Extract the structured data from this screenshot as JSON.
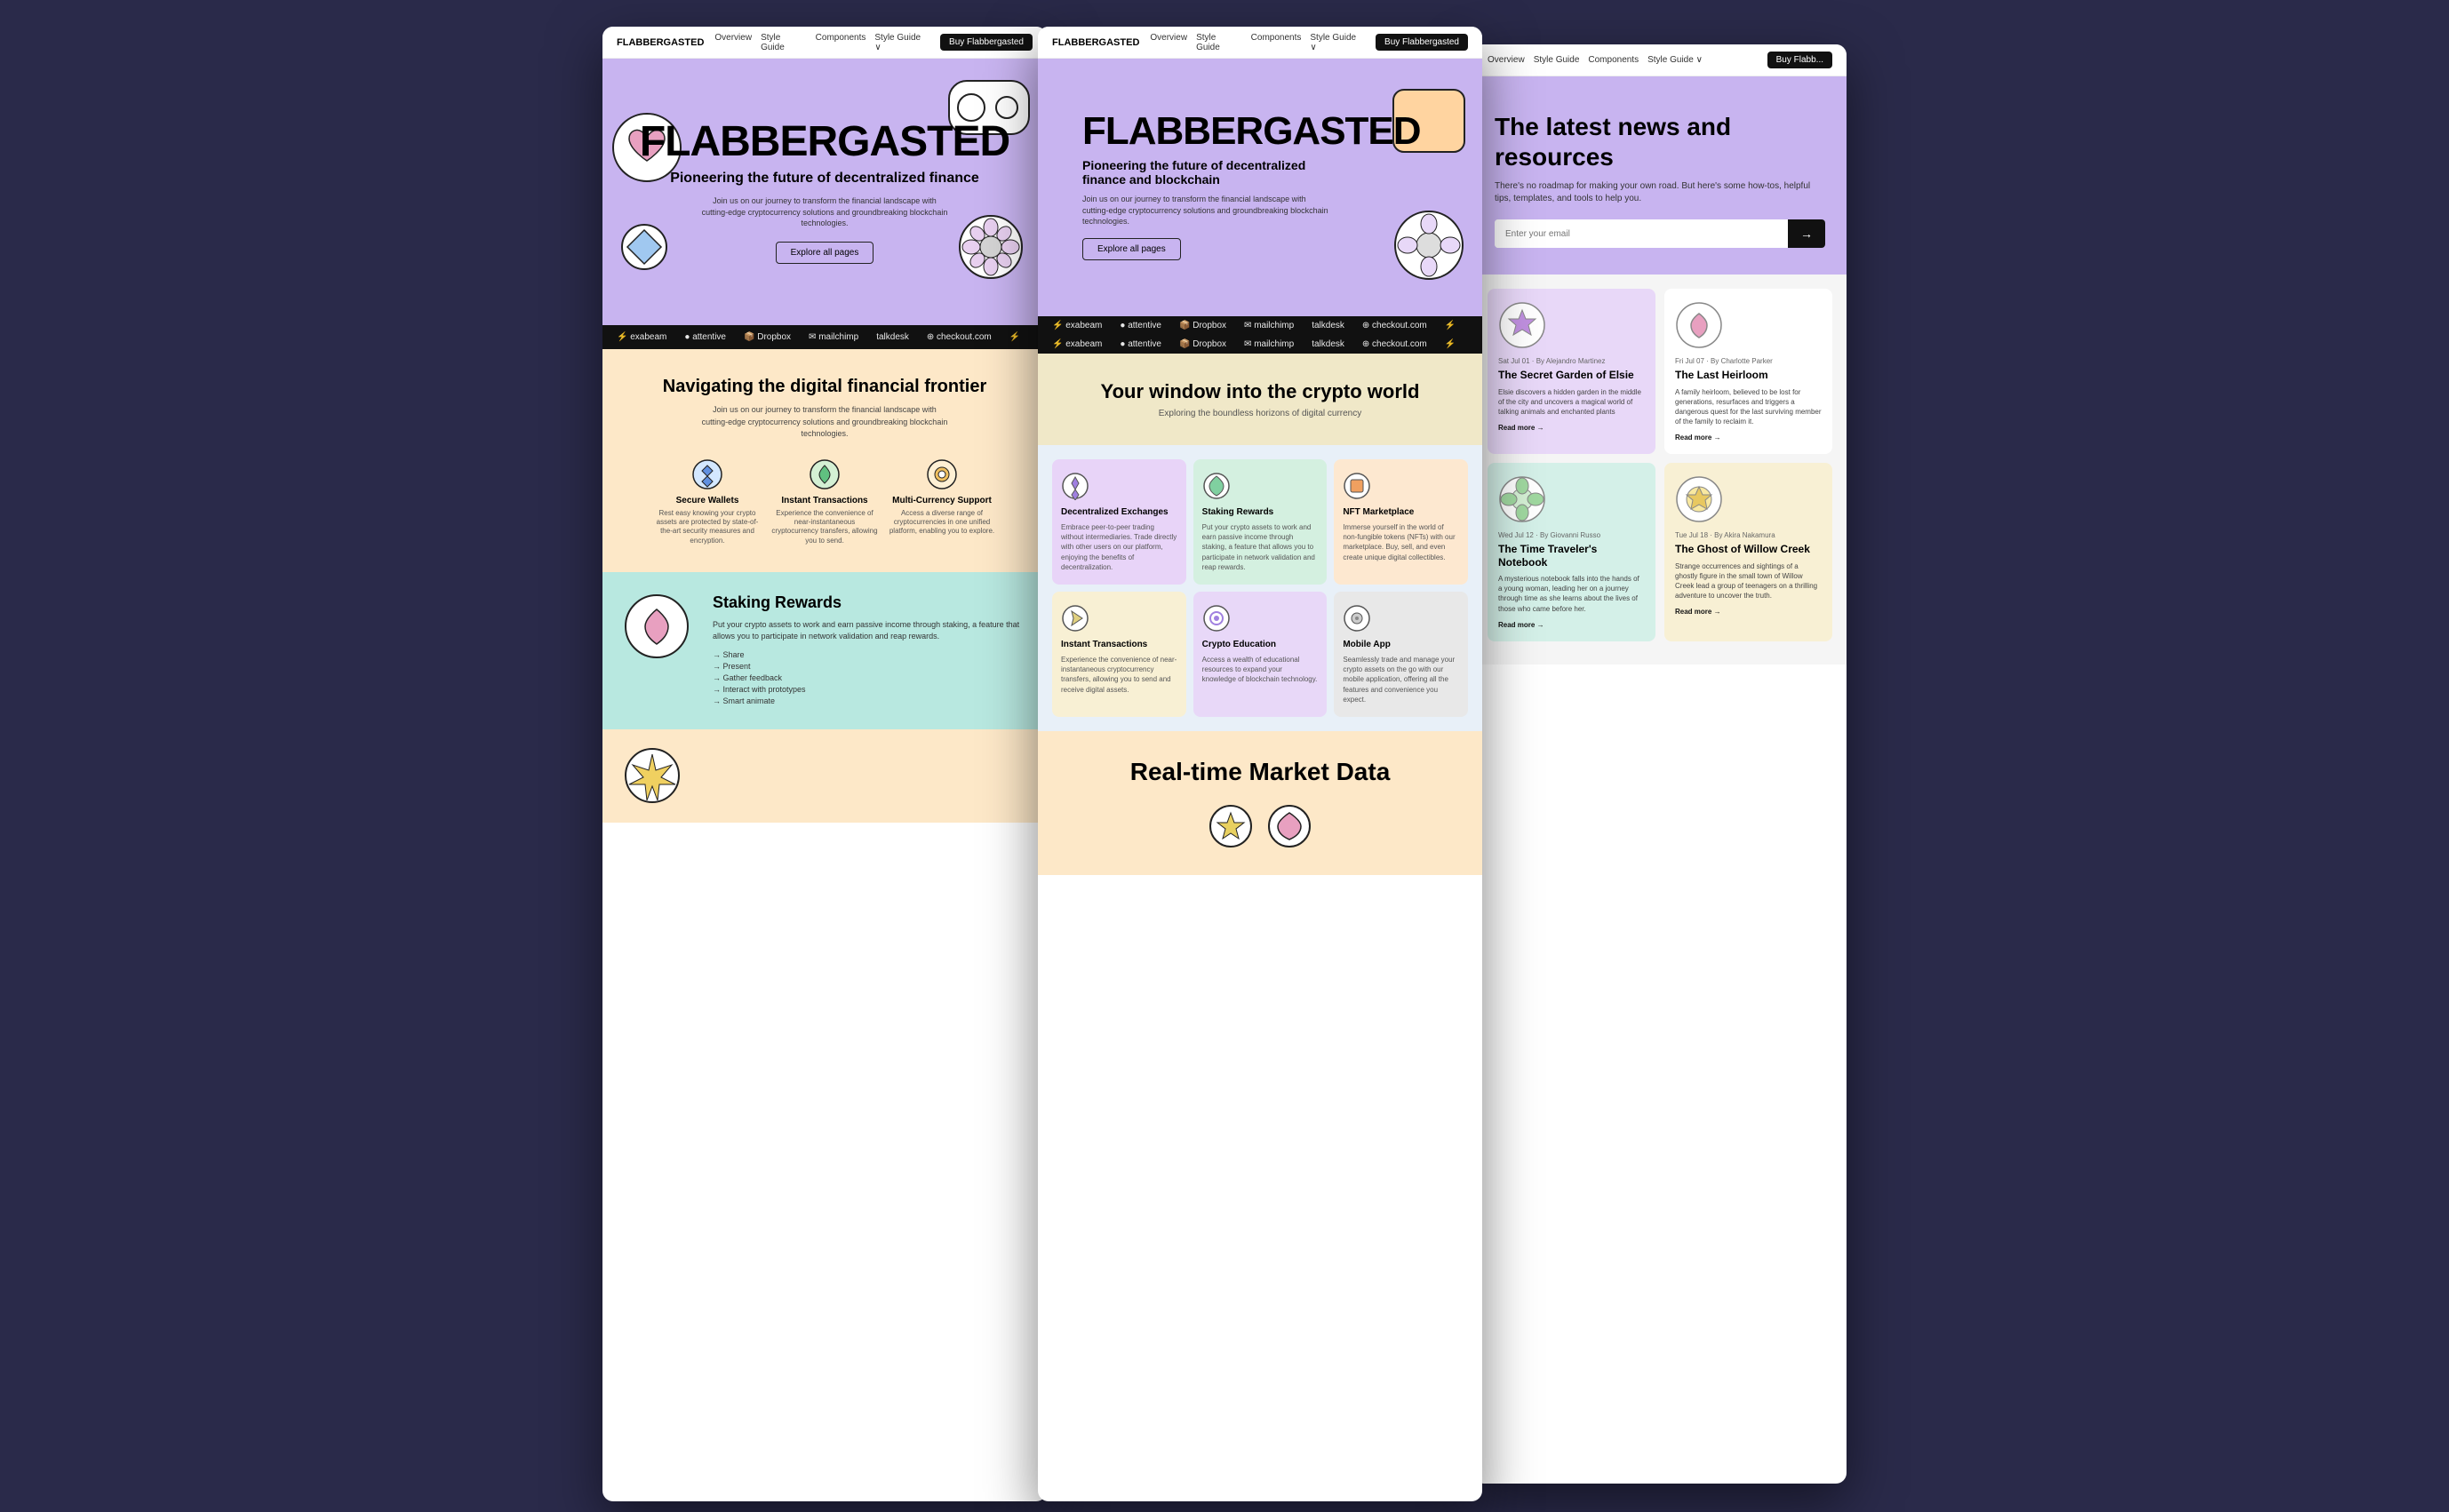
{
  "screens": {
    "screen1": {
      "nav": {
        "logo": "FLABBERGASTED",
        "links": [
          "Overview",
          "Style Guide",
          "Components",
          "Style Guide"
        ],
        "cta": "Buy Flabbergasted"
      },
      "hero": {
        "title": "FLABBERGASTED",
        "subtitle": "Pioneering the future of decentralized finance",
        "body": "Join us on our journey to transform the financial landscape with cutting-edge cryptocurrency solutions and groundbreaking blockchain technologies.",
        "btn": "Explore all pages"
      },
      "brands": [
        "exabeam",
        "attentive",
        "Dropbox",
        "mailchimp",
        "talkdesk",
        "checkout.com"
      ],
      "section_peach": {
        "title": "Navigating the digital financial frontier",
        "body": "Join us on our journey to transform the financial landscape with cutting-edge cryptocurrency solutions and groundbreaking blockchain technologies.",
        "features": [
          {
            "title": "Secure Wallets",
            "body": "Rest easy knowing your crypto assets are protected by state-of-the-art security measures and encryption."
          },
          {
            "title": "Instant Transactions",
            "body": "Experience the convenience of near-instantaneous cryptocurrency transfers, allowing you to send."
          },
          {
            "title": "Multi-Currency Support",
            "body": "Access a diverse range of cryptocurrencies in one unified platform, enabling you to explore."
          }
        ]
      },
      "section_staking": {
        "title": "Staking Rewards",
        "body": "Put your crypto assets to work and earn passive income through staking, a feature that allows you to participate in network validation and reap rewards.",
        "list": [
          "Share",
          "Present",
          "Gather feedback",
          "Interact with prototypes",
          "Smart animate"
        ]
      }
    },
    "screen2": {
      "nav": {
        "logo": "FLABBERGASTED",
        "links": [
          "Overview",
          "Style Guide",
          "Components",
          "Style Guide"
        ],
        "cta": "Buy Flabbergasted"
      },
      "hero": {
        "title": "FLABBERGASTED",
        "subtitle": "Pioneering the future of decentralized finance and blockchain",
        "body": "Join us on our journey to transform the financial landscape with cutting-edge cryptocurrency solutions and groundbreaking blockchain technologies.",
        "btn": "Explore all pages"
      },
      "brands_double": [
        [
          "exabeam",
          "attentive",
          "Dropbox",
          "mailchimp",
          "talkdesk",
          "checkout.com"
        ],
        [
          "exabeam",
          "attentive",
          "Dropbox",
          "mailchimp",
          "talkdesk",
          "checkout.com"
        ]
      ],
      "section_window": {
        "title": "Your window into the crypto world",
        "subtitle": "Exploring the boundless horizons of digital currency"
      },
      "cards": [
        {
          "title": "Decentralized Exchanges",
          "body": "Embrace peer-to-peer trading without intermediaries. Trade directly with other users on our platform, enjoying the benefits of decentralization.",
          "color": "purple"
        },
        {
          "title": "Staking Rewards",
          "body": "Put your crypto assets to work and earn passive income through staking, a feature that allows you to participate in network validation and reap rewards.",
          "color": "green"
        },
        {
          "title": "NFT Marketplace",
          "body": "Immerse yourself in the world of non-fungible tokens (NFTs) with our marketplace. Buy, sell, and even create unique digital collectibles.",
          "color": "orange"
        },
        {
          "title": "Instant Transactions",
          "body": "Experience the convenience of near-instantaneous cryptocurrency transfers, allowing you to send and receive digital assets.",
          "color": "yellow"
        },
        {
          "title": "Crypto Education",
          "body": "Access a wealth of educational resources to expand your knowledge of blockchain technology.",
          "color": "purple"
        },
        {
          "title": "Mobile App",
          "body": "Seamlessly trade and manage your crypto assets on the go with our mobile application, offering all the features and convenience you expect.",
          "color": "gray"
        }
      ],
      "section_realtime": {
        "title": "Real-time Market Data"
      }
    },
    "screen3": {
      "nav": {
        "links": [
          "Overview",
          "Style Guide",
          "Components",
          "Style Guide"
        ],
        "cta": "Buy Flabb..."
      },
      "news": {
        "title": "The latest news and resources",
        "subtitle": "There's no roadmap for making your own road. But here's some how-tos, helpful tips, templates, and tools to help you.",
        "email_placeholder": "Enter your email",
        "articles": [
          {
            "date": "Sat Jul 01 · By Alejandro Martinez",
            "title": "The Secret Garden of Elsie",
            "body": "Elsie discovers a hidden garden in the middle of the city and uncovers a magical world of talking animals and enchanted plants",
            "link": "Read more",
            "color": "purple"
          },
          {
            "date": "Fri Jul 07 · By Charlotte Parker",
            "title": "The Last Heirloom",
            "body": "A family heirloom, believed to be lost for generations, resurfaces and triggers a dangerous quest for the last surviving member of the family to reclaim it.",
            "link": "Read more",
            "color": "default"
          },
          {
            "date": "Wed Jul 12 · By Giovanni Russo",
            "title": "The Time Traveler's Notebook",
            "body": "A mysterious notebook falls into the hands of a young woman, leading her on a journey through time as she learns about the lives of those who came before her.",
            "link": "Read more",
            "color": "green"
          },
          {
            "date": "Tue Jul 18 · By Akira Nakamura",
            "title": "The Ghost of Willow Creek",
            "body": "Strange occurrences and sightings of a ghostly figure in the small town of Willow Creek lead a group of teenagers on a thrilling adventure to uncover the truth.",
            "link": "Read more",
            "color": "yellow"
          }
        ]
      }
    }
  },
  "icons": {
    "heart": "♥",
    "diamond": "◆",
    "star": "✦",
    "circle": "●",
    "arrow_right": "→"
  }
}
